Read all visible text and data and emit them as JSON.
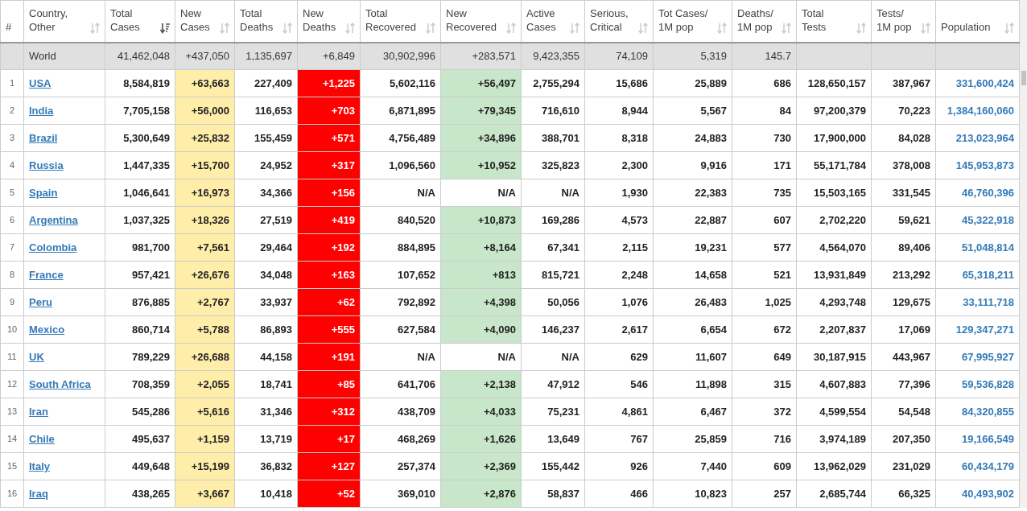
{
  "columns": [
    {
      "label": "#",
      "kind": "rank"
    },
    {
      "label": "Country,\nOther",
      "sorted": false,
      "kind": "country"
    },
    {
      "label": "Total\nCases",
      "sorted": true,
      "kind": "plain"
    },
    {
      "label": "New\nCases",
      "sorted": false,
      "kind": "new_cases"
    },
    {
      "label": "Total\nDeaths",
      "sorted": false,
      "kind": "plain"
    },
    {
      "label": "New\nDeaths",
      "sorted": false,
      "kind": "new_deaths"
    },
    {
      "label": "Total\nRecovered",
      "sorted": false,
      "kind": "plain"
    },
    {
      "label": "New\nRecovered",
      "sorted": false,
      "kind": "new_recovered"
    },
    {
      "label": "Active\nCases",
      "sorted": false,
      "kind": "plain"
    },
    {
      "label": "Serious,\nCritical",
      "sorted": false,
      "kind": "plain"
    },
    {
      "label": "Tot Cases/\n1M pop",
      "sorted": false,
      "kind": "plain"
    },
    {
      "label": "Deaths/\n1M pop",
      "sorted": false,
      "kind": "plain"
    },
    {
      "label": "Total\nTests",
      "sorted": false,
      "kind": "plain"
    },
    {
      "label": "Tests/\n1M pop",
      "sorted": false,
      "kind": "plain"
    },
    {
      "label": "Population",
      "sorted": false,
      "kind": "population"
    }
  ],
  "world": {
    "country": "World",
    "values": [
      "41,462,048",
      "+437,050",
      "1,135,697",
      "+6,849",
      "30,902,996",
      "+283,571",
      "9,423,355",
      "74,109",
      "5,319",
      "145.7"
    ]
  },
  "rows": [
    {
      "rank": "1",
      "country": "USA",
      "recovered_reported": true,
      "values": [
        "8,584,819",
        "+63,663",
        "227,409",
        "+1,225",
        "5,602,116",
        "+56,497",
        "2,755,294",
        "15,686",
        "25,889",
        "686",
        "128,650,157",
        "387,967",
        "331,600,424"
      ]
    },
    {
      "rank": "2",
      "country": "India",
      "recovered_reported": true,
      "values": [
        "7,705,158",
        "+56,000",
        "116,653",
        "+703",
        "6,871,895",
        "+79,345",
        "716,610",
        "8,944",
        "5,567",
        "84",
        "97,200,379",
        "70,223",
        "1,384,160,060"
      ]
    },
    {
      "rank": "3",
      "country": "Brazil",
      "recovered_reported": true,
      "values": [
        "5,300,649",
        "+25,832",
        "155,459",
        "+571",
        "4,756,489",
        "+34,896",
        "388,701",
        "8,318",
        "24,883",
        "730",
        "17,900,000",
        "84,028",
        "213,023,964"
      ]
    },
    {
      "rank": "4",
      "country": "Russia",
      "recovered_reported": true,
      "values": [
        "1,447,335",
        "+15,700",
        "24,952",
        "+317",
        "1,096,560",
        "+10,952",
        "325,823",
        "2,300",
        "9,916",
        "171",
        "55,171,784",
        "378,008",
        "145,953,873"
      ]
    },
    {
      "rank": "5",
      "country": "Spain",
      "recovered_reported": false,
      "values": [
        "1,046,641",
        "+16,973",
        "34,366",
        "+156",
        "N/A",
        "N/A",
        "N/A",
        "1,930",
        "22,383",
        "735",
        "15,503,165",
        "331,545",
        "46,760,396"
      ]
    },
    {
      "rank": "6",
      "country": "Argentina",
      "recovered_reported": true,
      "values": [
        "1,037,325",
        "+18,326",
        "27,519",
        "+419",
        "840,520",
        "+10,873",
        "169,286",
        "4,573",
        "22,887",
        "607",
        "2,702,220",
        "59,621",
        "45,322,918"
      ]
    },
    {
      "rank": "7",
      "country": "Colombia",
      "recovered_reported": true,
      "values": [
        "981,700",
        "+7,561",
        "29,464",
        "+192",
        "884,895",
        "+8,164",
        "67,341",
        "2,115",
        "19,231",
        "577",
        "4,564,070",
        "89,406",
        "51,048,814"
      ]
    },
    {
      "rank": "8",
      "country": "France",
      "recovered_reported": true,
      "values": [
        "957,421",
        "+26,676",
        "34,048",
        "+163",
        "107,652",
        "+813",
        "815,721",
        "2,248",
        "14,658",
        "521",
        "13,931,849",
        "213,292",
        "65,318,211"
      ]
    },
    {
      "rank": "9",
      "country": "Peru",
      "recovered_reported": true,
      "values": [
        "876,885",
        "+2,767",
        "33,937",
        "+62",
        "792,892",
        "+4,398",
        "50,056",
        "1,076",
        "26,483",
        "1,025",
        "4,293,748",
        "129,675",
        "33,111,718"
      ]
    },
    {
      "rank": "10",
      "country": "Mexico",
      "recovered_reported": true,
      "values": [
        "860,714",
        "+5,788",
        "86,893",
        "+555",
        "627,584",
        "+4,090",
        "146,237",
        "2,617",
        "6,654",
        "672",
        "2,207,837",
        "17,069",
        "129,347,271"
      ]
    },
    {
      "rank": "11",
      "country": "UK",
      "recovered_reported": false,
      "values": [
        "789,229",
        "+26,688",
        "44,158",
        "+191",
        "N/A",
        "N/A",
        "N/A",
        "629",
        "11,607",
        "649",
        "30,187,915",
        "443,967",
        "67,995,927"
      ]
    },
    {
      "rank": "12",
      "country": "South Africa",
      "recovered_reported": true,
      "values": [
        "708,359",
        "+2,055",
        "18,741",
        "+85",
        "641,706",
        "+2,138",
        "47,912",
        "546",
        "11,898",
        "315",
        "4,607,883",
        "77,396",
        "59,536,828"
      ]
    },
    {
      "rank": "13",
      "country": "Iran",
      "recovered_reported": true,
      "values": [
        "545,286",
        "+5,616",
        "31,346",
        "+312",
        "438,709",
        "+4,033",
        "75,231",
        "4,861",
        "6,467",
        "372",
        "4,599,554",
        "54,548",
        "84,320,855"
      ]
    },
    {
      "rank": "14",
      "country": "Chile",
      "recovered_reported": true,
      "values": [
        "495,637",
        "+1,159",
        "13,719",
        "+17",
        "468,269",
        "+1,626",
        "13,649",
        "767",
        "25,859",
        "716",
        "3,974,189",
        "207,350",
        "19,166,549"
      ]
    },
    {
      "rank": "15",
      "country": "Italy",
      "recovered_reported": true,
      "values": [
        "449,648",
        "+15,199",
        "36,832",
        "+127",
        "257,374",
        "+2,369",
        "155,442",
        "926",
        "7,440",
        "609",
        "13,962,029",
        "231,029",
        "60,434,179"
      ]
    },
    {
      "rank": "16",
      "country": "Iraq",
      "recovered_reported": true,
      "values": [
        "438,265",
        "+3,667",
        "10,418",
        "+52",
        "369,010",
        "+2,876",
        "58,837",
        "466",
        "10,823",
        "257",
        "2,685,744",
        "66,325",
        "40,493,902"
      ]
    }
  ]
}
